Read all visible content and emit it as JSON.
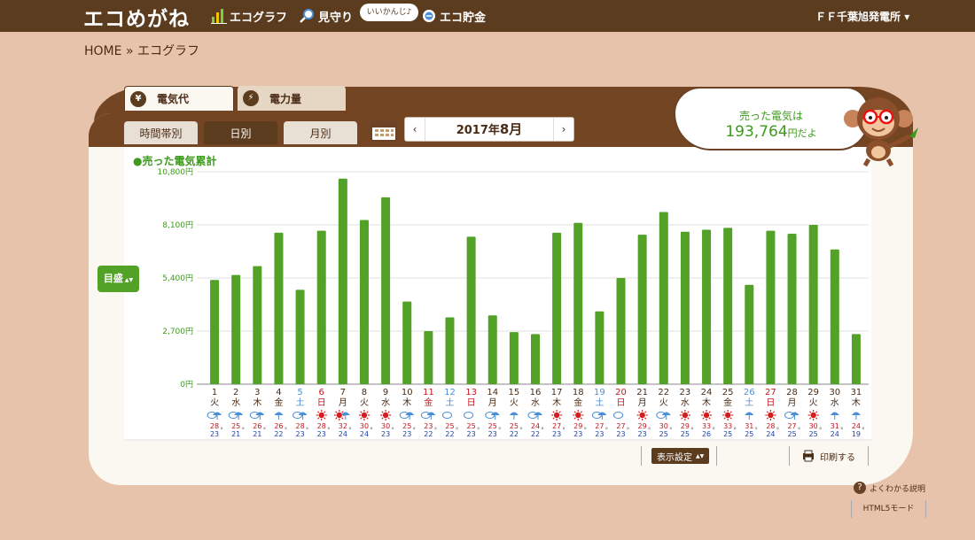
{
  "header": {
    "logo": "エコめがね",
    "nav": [
      {
        "label": "エコグラフ",
        "icon": "bar-chart-icon"
      },
      {
        "label": "見守り",
        "icon": "magnifier-icon"
      },
      {
        "label": "エコ貯金",
        "icon": "coin-icon"
      }
    ],
    "bubble": "いいかんじ♪",
    "plant": "ＦＦ千葉旭発電所",
    "plant_caret": "▾"
  },
  "breadcrumb": {
    "home": "HOME",
    "sep": "»",
    "current": "エコグラフ"
  },
  "tabs": [
    {
      "label": "電気代",
      "icon": "yen-icon",
      "glyph": "¥"
    },
    {
      "label": "電力量",
      "icon": "lightning-icon",
      "glyph": "⚡"
    }
  ],
  "subtabs": [
    "時間帯別",
    "日別",
    "月別"
  ],
  "month": {
    "year": "2017年",
    "month": "8月",
    "prev": "‹",
    "next": "›"
  },
  "sold": {
    "label": "売った電気は",
    "value": "193,764",
    "suffix": "円だよ"
  },
  "goal": {
    "label": "目盛",
    "arrows": "▲▼"
  },
  "toolbar": {
    "display": "表示設定",
    "display_arrows": "▲▼",
    "print": "印刷する",
    "help": "よくわかる説明",
    "help_glyph": "?",
    "html5": "HTML5モード"
  },
  "chart_data": {
    "type": "bar",
    "legend": "●売った電気累計",
    "ylim": [
      0,
      10800
    ],
    "yticks": [
      "0円",
      "2,700円",
      "5,400円",
      "8,100円",
      "10,800円"
    ],
    "days": [
      "1",
      "2",
      "3",
      "4",
      "5",
      "6",
      "7",
      "8",
      "9",
      "10",
      "11",
      "12",
      "13",
      "14",
      "15",
      "16",
      "17",
      "18",
      "19",
      "20",
      "21",
      "22",
      "23",
      "24",
      "25",
      "26",
      "27",
      "28",
      "29",
      "30",
      "31"
    ],
    "weekdays": [
      "火",
      "水",
      "木",
      "金",
      "土",
      "日",
      "月",
      "火",
      "水",
      "木",
      "金",
      "土",
      "日",
      "月",
      "火",
      "水",
      "木",
      "金",
      "土",
      "日",
      "月",
      "火",
      "水",
      "木",
      "金",
      "土",
      "日",
      "月",
      "火",
      "水",
      "木"
    ],
    "day_colors": [
      "#4b2c16",
      "#4b2c16",
      "#4b2c16",
      "#4b2c16",
      "#4a8fd8",
      "#c8141e",
      "#4b2c16",
      "#4b2c16",
      "#4b2c16",
      "#4b2c16",
      "#c8141e",
      "#4a8fd8",
      "#c8141e",
      "#4b2c16",
      "#4b2c16",
      "#4b2c16",
      "#4b2c16",
      "#4b2c16",
      "#4a8fd8",
      "#c8141e",
      "#4b2c16",
      "#4b2c16",
      "#4b2c16",
      "#4b2c16",
      "#4b2c16",
      "#4a8fd8",
      "#c8141e",
      "#4b2c16",
      "#4b2c16",
      "#4b2c16",
      "#4b2c16"
    ],
    "values": [
      5300,
      5550,
      6000,
      7700,
      4800,
      7800,
      10450,
      8350,
      9500,
      4200,
      2700,
      3400,
      7500,
      3500,
      2650,
      2550,
      7700,
      8200,
      3700,
      5400,
      7600,
      8750,
      7750,
      7850,
      7950,
      5050,
      7800,
      7650,
      8100,
      6850,
      2550
    ],
    "weather": [
      "cloud-umbrella",
      "cloud-umbrella",
      "cloud-umbrella",
      "umbrella",
      "cloud-umbrella",
      "sun",
      "sun-umbrella",
      "sun",
      "sun",
      "cloud-umbrella",
      "cloud-umbrella",
      "cloud",
      "cloud",
      "cloud-umbrella",
      "umbrella",
      "cloud-umbrella",
      "sun",
      "sun",
      "cloud-umbrella",
      "cloud",
      "sun",
      "cloud-umbrella",
      "sun",
      "sun",
      "sun",
      "umbrella",
      "sun",
      "cloud-umbrella",
      "sun",
      "umbrella",
      "umbrella"
    ],
    "high": [
      "28",
      "25",
      "26",
      "26",
      "28",
      "28",
      "32",
      "30",
      "30",
      "25",
      "23",
      "25",
      "25",
      "25",
      "25",
      "24",
      "27",
      "29",
      "27",
      "27",
      "29",
      "30",
      "29",
      "33",
      "33",
      "31",
      "28",
      "27",
      "30",
      "31",
      "24"
    ],
    "low": [
      "23",
      "21",
      "21",
      "22",
      "23",
      "23",
      "24",
      "24",
      "23",
      "23",
      "22",
      "22",
      "23",
      "23",
      "22",
      "22",
      "23",
      "23",
      "23",
      "23",
      "23",
      "25",
      "25",
      "26",
      "25",
      "25",
      "24",
      "25",
      "25",
      "24",
      "19"
    ],
    "deg": "°",
    "colors": {
      "bar": "#52a228",
      "high": "#c8141e",
      "low": "#1f3fa8",
      "grid": "#e0e0e0"
    }
  }
}
